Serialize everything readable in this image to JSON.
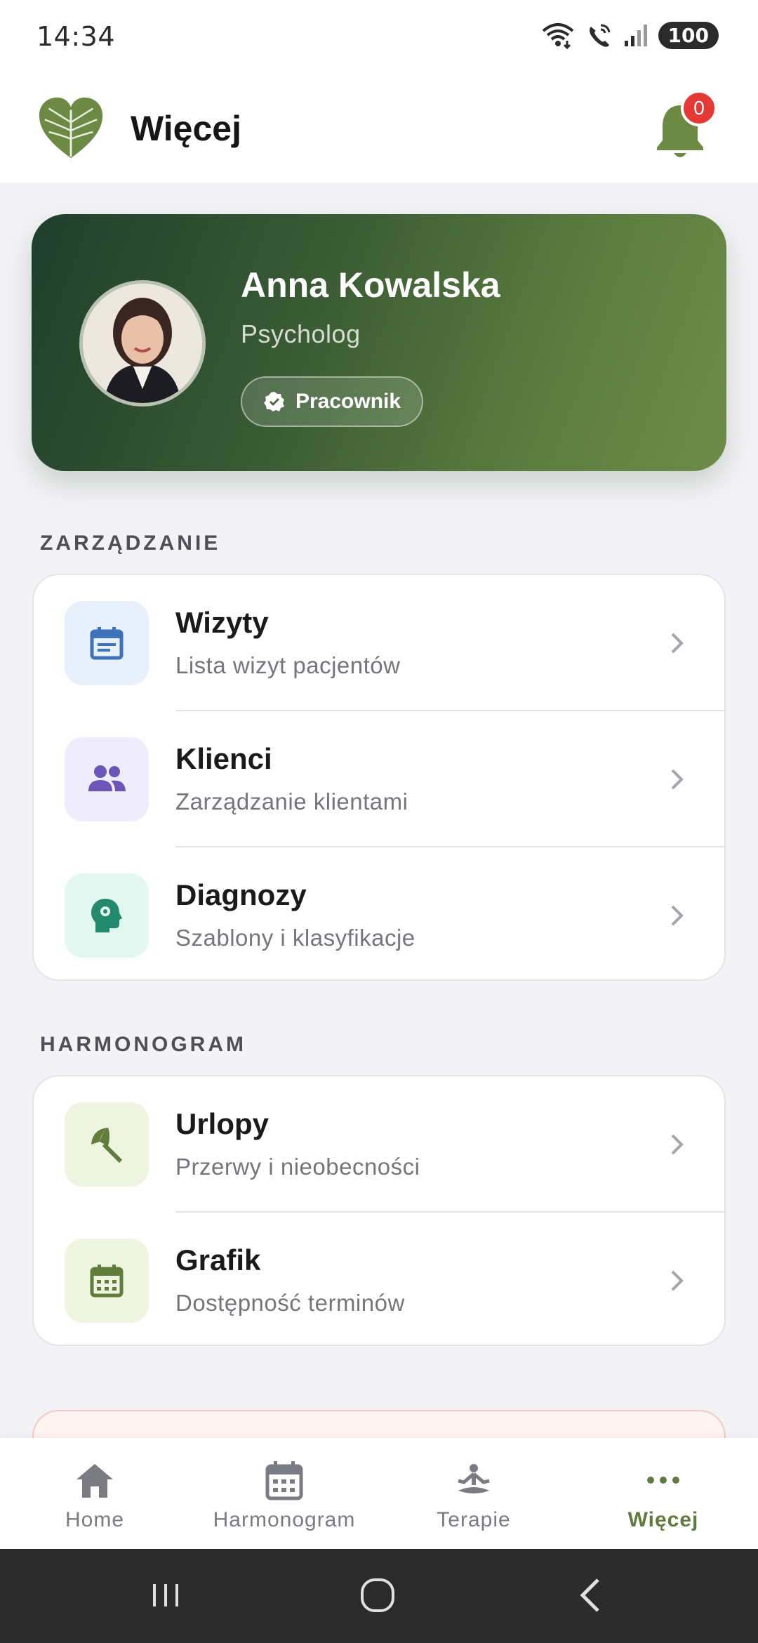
{
  "status_bar": {
    "time": "14:34",
    "battery": "100",
    "icons": [
      "wifi-icon",
      "wifi-calling-icon",
      "signal-icon"
    ]
  },
  "header": {
    "title": "Więcej",
    "notification_count": "0",
    "logo_icon": "leaf-heart-logo",
    "bell_icon": "bell-icon"
  },
  "profile": {
    "name": "Anna Kowalska",
    "role": "Psycholog",
    "badge": "Pracownik",
    "badge_icon": "verified-icon"
  },
  "sections": [
    {
      "title": "ZARZĄDZANIE",
      "items": [
        {
          "title": "Wizyty",
          "subtitle": "Lista wizyt pacjentów",
          "icon": "calendar-event-icon",
          "icon_bg": "#e8f0fc",
          "icon_color": "#3f72b8"
        },
        {
          "title": "Klienci",
          "subtitle": "Zarządzanie klientami",
          "icon": "people-icon",
          "icon_bg": "#efecfb",
          "icon_color": "#6a57b8"
        },
        {
          "title": "Diagnozy",
          "subtitle": "Szablony i klasyfikacje",
          "icon": "psychology-icon",
          "icon_bg": "#e3f6f0",
          "icon_color": "#238a6e"
        }
      ]
    },
    {
      "title": "HARMONOGRAM",
      "items": [
        {
          "title": "Urlopy",
          "subtitle": "Przerwy i nieobecności",
          "icon": "beach-umbrella-icon",
          "icon_bg": "#eef4df",
          "icon_color": "#607d3b"
        },
        {
          "title": "Grafik",
          "subtitle": "Dostępność terminów",
          "icon": "calendar-grid-icon",
          "icon_bg": "#eef4df",
          "icon_color": "#607d3b"
        }
      ]
    }
  ],
  "bottom_nav": [
    {
      "label": "Home",
      "icon": "home-icon",
      "active": false
    },
    {
      "label": "Harmonogram",
      "icon": "calendar-icon",
      "active": false
    },
    {
      "label": "Terapie",
      "icon": "meditation-icon",
      "active": false
    },
    {
      "label": "Więcej",
      "icon": "more-horizontal-icon",
      "active": true
    }
  ],
  "colors": {
    "accent": "#5f7b3d",
    "badge_red": "#e53935",
    "card_gradient_start": "#1f3e2c",
    "card_gradient_end": "#6e8b48",
    "nav_inactive": "#7b7b83"
  }
}
